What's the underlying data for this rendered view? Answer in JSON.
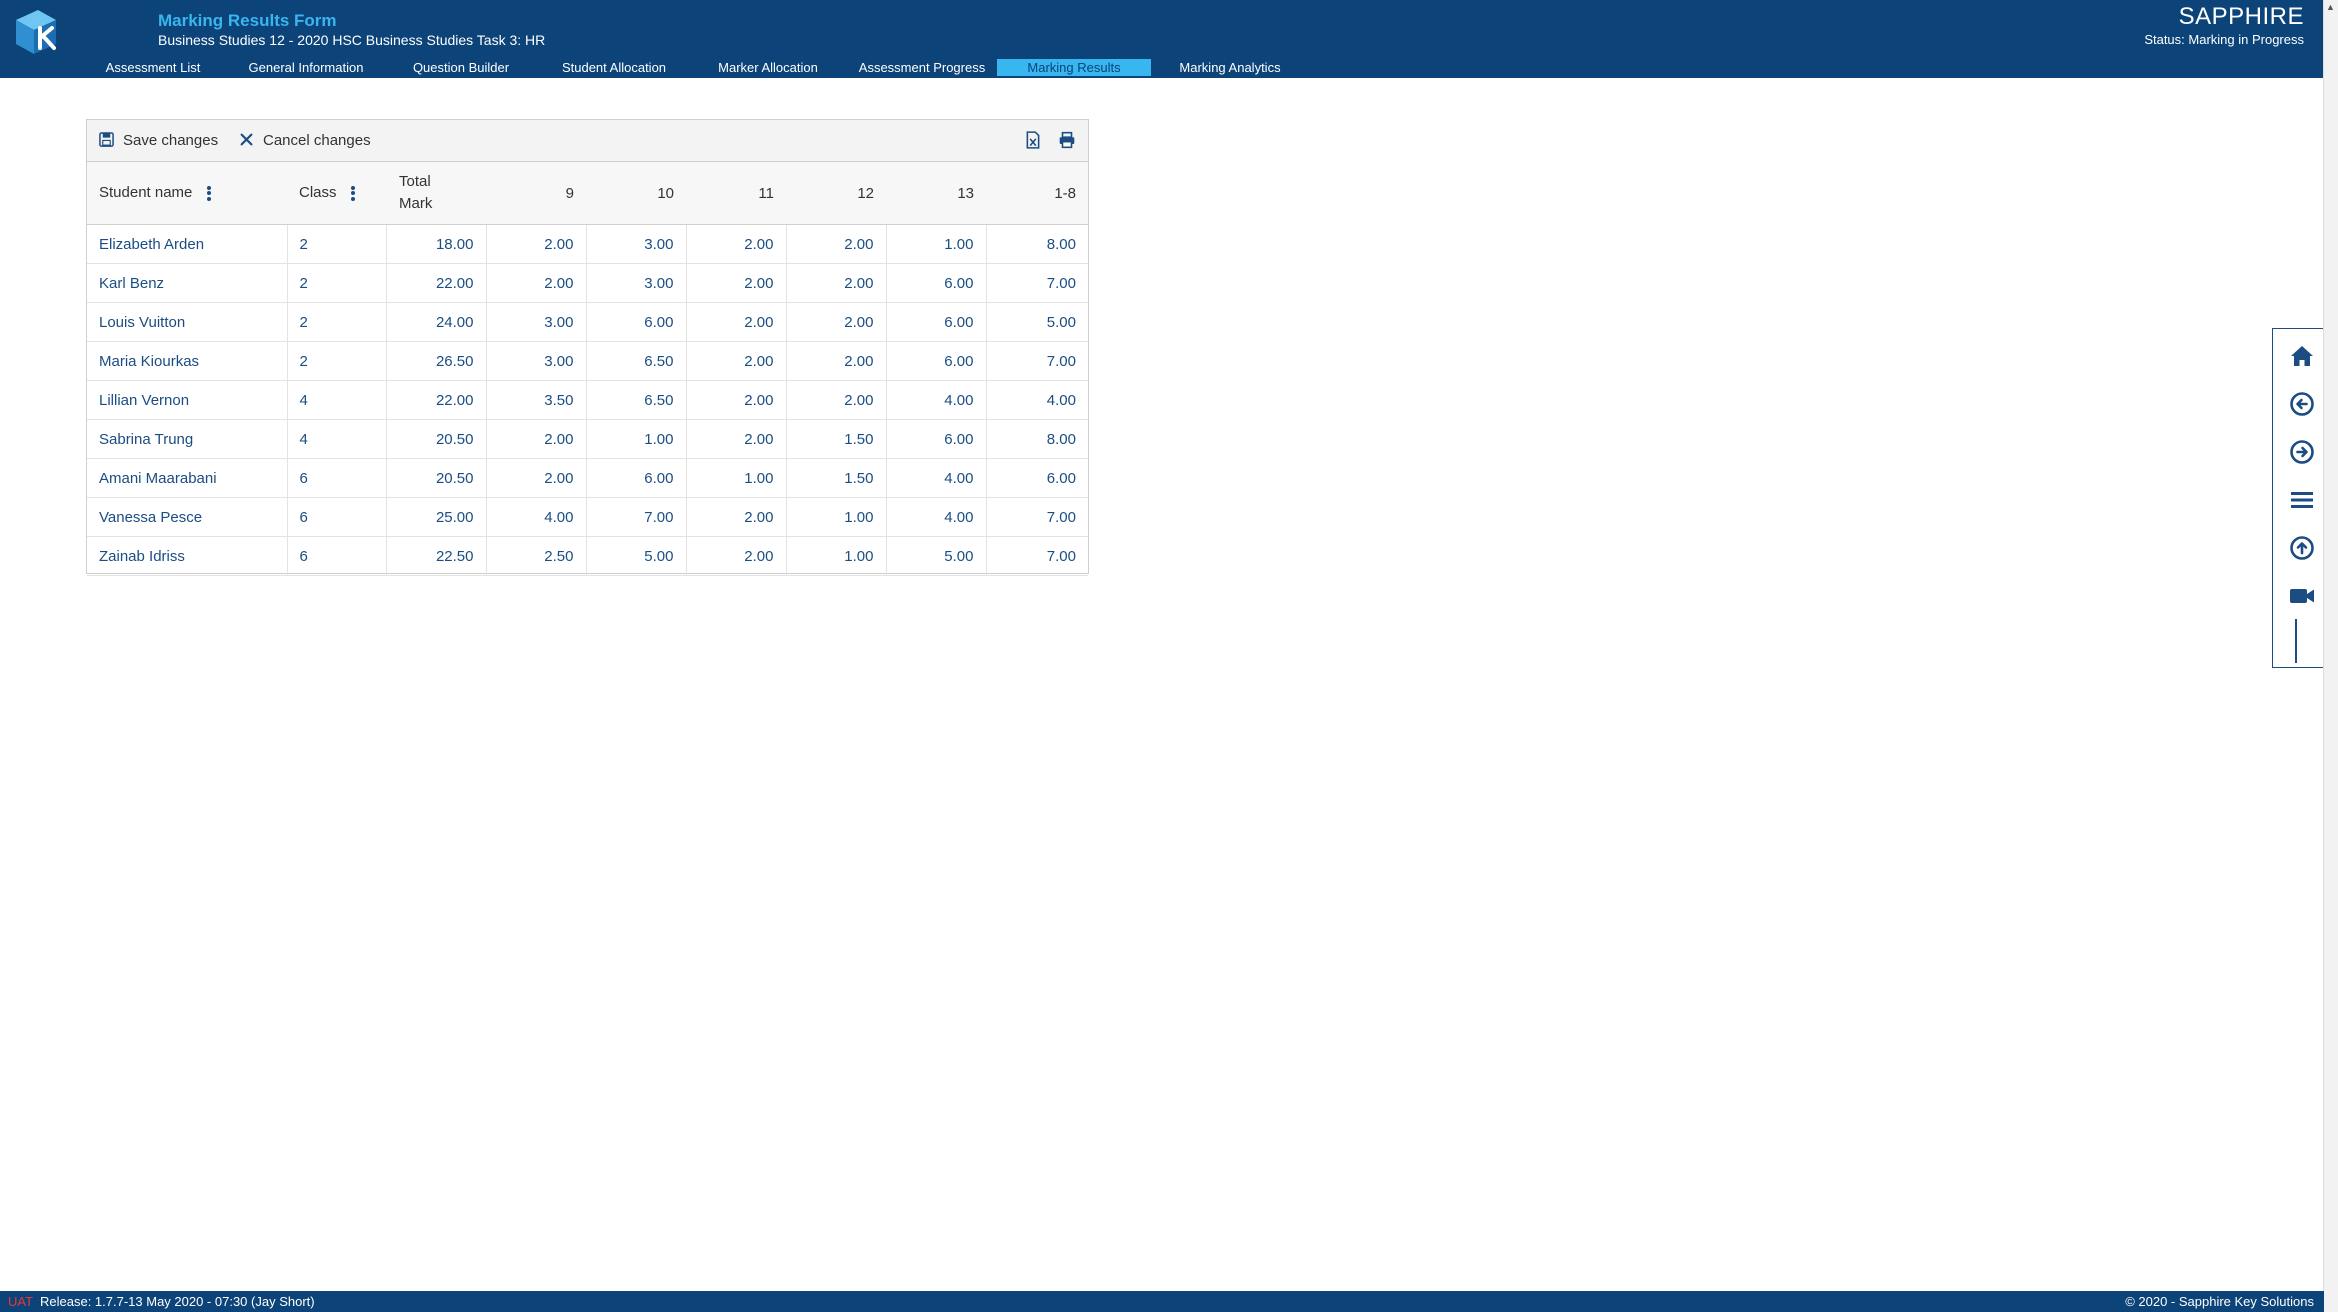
{
  "header": {
    "form_title": "Marking Results Form",
    "form_subtitle": "Business Studies 12 - 2020 HSC Business Studies Task 3: HR",
    "brand": "SAPPHIRE",
    "status": "Status: Marking in Progress",
    "nav_tabs": [
      {
        "label": "Assessment List"
      },
      {
        "label": "General Information"
      },
      {
        "label": "Question Builder"
      },
      {
        "label": "Student Allocation"
      },
      {
        "label": "Marker Allocation"
      },
      {
        "label": "Assessment Progress"
      },
      {
        "label": "Marking Results",
        "active": true
      },
      {
        "label": "Marking Analytics"
      }
    ],
    "brand_color": "#0c4379",
    "accent_color": "#38b6f0"
  },
  "toolbar": {
    "save_label": "Save changes",
    "cancel_label": "Cancel changes",
    "icons": [
      "save-icon",
      "close-icon",
      "excel-export-icon",
      "print-icon"
    ]
  },
  "grid": {
    "columns": [
      "Student name",
      "Class",
      "Total Mark",
      "9",
      "10",
      "11",
      "12",
      "13",
      "1-8"
    ],
    "rows": [
      [
        "Elizabeth Arden",
        "2",
        "18.00",
        "2.00",
        "3.00",
        "2.00",
        "2.00",
        "1.00",
        "8.00"
      ],
      [
        "Karl Benz",
        "2",
        "22.00",
        "2.00",
        "3.00",
        "2.00",
        "2.00",
        "6.00",
        "7.00"
      ],
      [
        "Louis Vuitton",
        "2",
        "24.00",
        "3.00",
        "6.00",
        "2.00",
        "2.00",
        "6.00",
        "5.00"
      ],
      [
        "Maria Kiourkas",
        "2",
        "26.50",
        "3.00",
        "6.50",
        "2.00",
        "2.00",
        "6.00",
        "7.00"
      ],
      [
        "Lillian Vernon",
        "4",
        "22.00",
        "3.50",
        "6.50",
        "2.00",
        "2.00",
        "4.00",
        "4.00"
      ],
      [
        "Sabrina Trung",
        "4",
        "20.50",
        "2.00",
        "1.00",
        "2.00",
        "1.50",
        "6.00",
        "8.00"
      ],
      [
        "Amani Maarabani",
        "6",
        "20.50",
        "2.00",
        "6.00",
        "1.00",
        "1.50",
        "4.00",
        "6.00"
      ],
      [
        "Vanessa Pesce",
        "6",
        "25.00",
        "4.00",
        "7.00",
        "2.00",
        "1.00",
        "4.00",
        "7.00"
      ],
      [
        "Zainab Idriss",
        "6",
        "22.50",
        "2.50",
        "5.00",
        "2.00",
        "1.00",
        "5.00",
        "7.00"
      ]
    ]
  },
  "side_rail": {
    "icons": [
      "home-icon",
      "back-icon",
      "forward-icon",
      "menu-icon",
      "scroll-top-icon",
      "video-icon"
    ]
  },
  "footer": {
    "env": "UAT",
    "release": "Release: 1.7.7-13 May 2020 - 07:30   (Jay Short)",
    "copyright": "© 2020 - Sapphire Key Solutions"
  }
}
